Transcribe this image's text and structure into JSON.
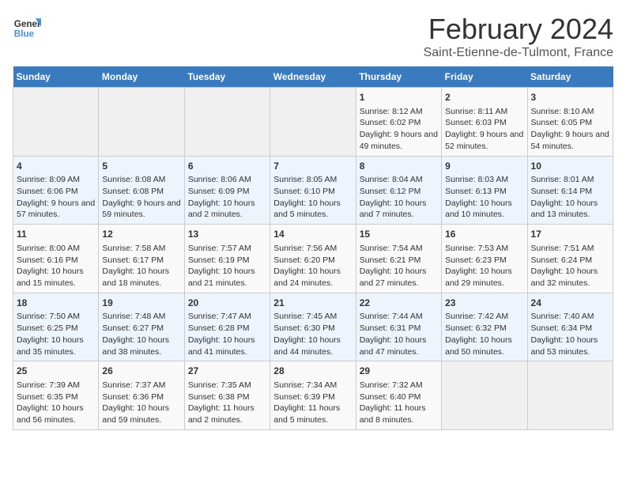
{
  "logo": {
    "line1": "General",
    "line2": "Blue"
  },
  "title": "February 2024",
  "subtitle": "Saint-Etienne-de-Tulmont, France",
  "weekdays": [
    "Sunday",
    "Monday",
    "Tuesday",
    "Wednesday",
    "Thursday",
    "Friday",
    "Saturday"
  ],
  "weeks": [
    [
      {
        "day": "",
        "info": ""
      },
      {
        "day": "",
        "info": ""
      },
      {
        "day": "",
        "info": ""
      },
      {
        "day": "",
        "info": ""
      },
      {
        "day": "1",
        "info": "Sunrise: 8:12 AM\nSunset: 6:02 PM\nDaylight: 9 hours and 49 minutes."
      },
      {
        "day": "2",
        "info": "Sunrise: 8:11 AM\nSunset: 6:03 PM\nDaylight: 9 hours and 52 minutes."
      },
      {
        "day": "3",
        "info": "Sunrise: 8:10 AM\nSunset: 6:05 PM\nDaylight: 9 hours and 54 minutes."
      }
    ],
    [
      {
        "day": "4",
        "info": "Sunrise: 8:09 AM\nSunset: 6:06 PM\nDaylight: 9 hours and 57 minutes."
      },
      {
        "day": "5",
        "info": "Sunrise: 8:08 AM\nSunset: 6:08 PM\nDaylight: 9 hours and 59 minutes."
      },
      {
        "day": "6",
        "info": "Sunrise: 8:06 AM\nSunset: 6:09 PM\nDaylight: 10 hours and 2 minutes."
      },
      {
        "day": "7",
        "info": "Sunrise: 8:05 AM\nSunset: 6:10 PM\nDaylight: 10 hours and 5 minutes."
      },
      {
        "day": "8",
        "info": "Sunrise: 8:04 AM\nSunset: 6:12 PM\nDaylight: 10 hours and 7 minutes."
      },
      {
        "day": "9",
        "info": "Sunrise: 8:03 AM\nSunset: 6:13 PM\nDaylight: 10 hours and 10 minutes."
      },
      {
        "day": "10",
        "info": "Sunrise: 8:01 AM\nSunset: 6:14 PM\nDaylight: 10 hours and 13 minutes."
      }
    ],
    [
      {
        "day": "11",
        "info": "Sunrise: 8:00 AM\nSunset: 6:16 PM\nDaylight: 10 hours and 15 minutes."
      },
      {
        "day": "12",
        "info": "Sunrise: 7:58 AM\nSunset: 6:17 PM\nDaylight: 10 hours and 18 minutes."
      },
      {
        "day": "13",
        "info": "Sunrise: 7:57 AM\nSunset: 6:19 PM\nDaylight: 10 hours and 21 minutes."
      },
      {
        "day": "14",
        "info": "Sunrise: 7:56 AM\nSunset: 6:20 PM\nDaylight: 10 hours and 24 minutes."
      },
      {
        "day": "15",
        "info": "Sunrise: 7:54 AM\nSunset: 6:21 PM\nDaylight: 10 hours and 27 minutes."
      },
      {
        "day": "16",
        "info": "Sunrise: 7:53 AM\nSunset: 6:23 PM\nDaylight: 10 hours and 29 minutes."
      },
      {
        "day": "17",
        "info": "Sunrise: 7:51 AM\nSunset: 6:24 PM\nDaylight: 10 hours and 32 minutes."
      }
    ],
    [
      {
        "day": "18",
        "info": "Sunrise: 7:50 AM\nSunset: 6:25 PM\nDaylight: 10 hours and 35 minutes."
      },
      {
        "day": "19",
        "info": "Sunrise: 7:48 AM\nSunset: 6:27 PM\nDaylight: 10 hours and 38 minutes."
      },
      {
        "day": "20",
        "info": "Sunrise: 7:47 AM\nSunset: 6:28 PM\nDaylight: 10 hours and 41 minutes."
      },
      {
        "day": "21",
        "info": "Sunrise: 7:45 AM\nSunset: 6:30 PM\nDaylight: 10 hours and 44 minutes."
      },
      {
        "day": "22",
        "info": "Sunrise: 7:44 AM\nSunset: 6:31 PM\nDaylight: 10 hours and 47 minutes."
      },
      {
        "day": "23",
        "info": "Sunrise: 7:42 AM\nSunset: 6:32 PM\nDaylight: 10 hours and 50 minutes."
      },
      {
        "day": "24",
        "info": "Sunrise: 7:40 AM\nSunset: 6:34 PM\nDaylight: 10 hours and 53 minutes."
      }
    ],
    [
      {
        "day": "25",
        "info": "Sunrise: 7:39 AM\nSunset: 6:35 PM\nDaylight: 10 hours and 56 minutes."
      },
      {
        "day": "26",
        "info": "Sunrise: 7:37 AM\nSunset: 6:36 PM\nDaylight: 10 hours and 59 minutes."
      },
      {
        "day": "27",
        "info": "Sunrise: 7:35 AM\nSunset: 6:38 PM\nDaylight: 11 hours and 2 minutes."
      },
      {
        "day": "28",
        "info": "Sunrise: 7:34 AM\nSunset: 6:39 PM\nDaylight: 11 hours and 5 minutes."
      },
      {
        "day": "29",
        "info": "Sunrise: 7:32 AM\nSunset: 6:40 PM\nDaylight: 11 hours and 8 minutes."
      },
      {
        "day": "",
        "info": ""
      },
      {
        "day": "",
        "info": ""
      }
    ]
  ]
}
